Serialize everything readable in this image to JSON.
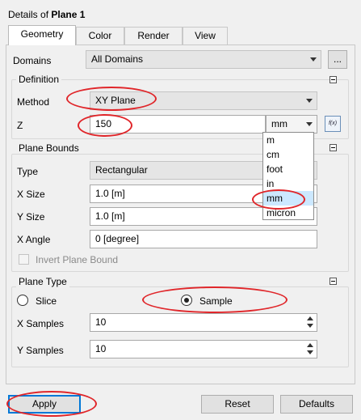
{
  "title": {
    "prefix": "Details of ",
    "name": "Plane 1"
  },
  "tabs": [
    "Geometry",
    "Color",
    "Render",
    "View"
  ],
  "domains": {
    "label": "Domains",
    "value": "All Domains",
    "more_label": "..."
  },
  "definition": {
    "title": "Definition",
    "method_label": "Method",
    "method_value": "XY Plane",
    "z_label": "Z",
    "z_value": "150",
    "z_unit": "mm",
    "expr_icon_text": "f(x)"
  },
  "unit_options": [
    "m",
    "cm",
    "foot",
    "in",
    "mm",
    "micron"
  ],
  "unit_selected_index": 4,
  "plane_bounds": {
    "title": "Plane Bounds",
    "type_label": "Type",
    "type_value": "Rectangular",
    "xsize_label": "X Size",
    "xsize_value": "1.0 [m]",
    "ysize_label": "Y Size",
    "ysize_value": "1.0 [m]",
    "xangle_label": "X Angle",
    "xangle_value": "0 [degree]",
    "invert_label": "Invert Plane Bound"
  },
  "plane_type": {
    "title": "Plane Type",
    "slice_label": "Slice",
    "sample_label": "Sample",
    "selected": "Sample",
    "xsamples_label": "X Samples",
    "xsamples_value": "10",
    "ysamples_label": "Y Samples",
    "ysamples_value": "10"
  },
  "buttons": {
    "apply": "Apply",
    "reset": "Reset",
    "defaults": "Defaults"
  },
  "colors": {
    "annotation": "#e0262a",
    "selection": "#cce8ff"
  }
}
